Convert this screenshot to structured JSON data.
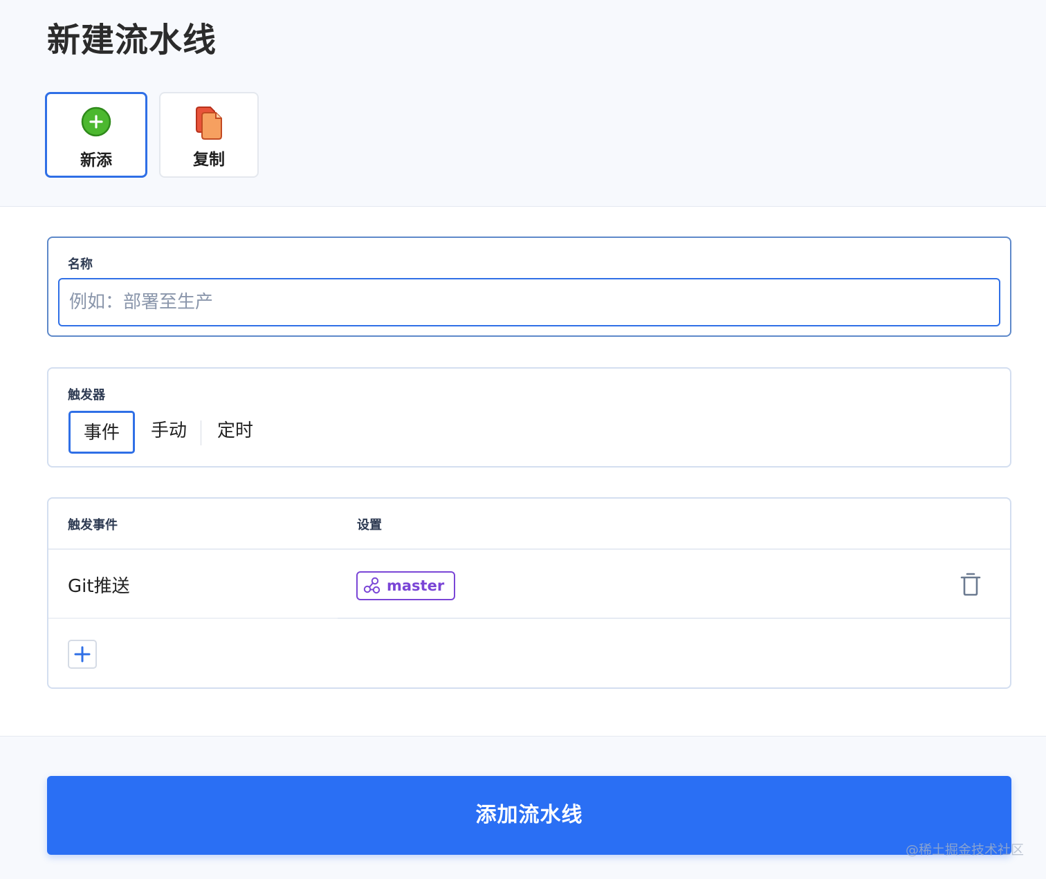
{
  "page": {
    "title": "新建流水线"
  },
  "modes": {
    "new_label": "新添",
    "copy_label": "复制"
  },
  "name_field": {
    "label": "名称",
    "value": "",
    "placeholder": "例如：部署至生产"
  },
  "trigger": {
    "label": "触发器",
    "options": [
      "事件",
      "手动",
      "定时"
    ],
    "selected": "事件"
  },
  "events_table": {
    "headers": [
      "触发事件",
      "设置"
    ],
    "rows": [
      {
        "event": "Git推送",
        "branch": "master"
      }
    ]
  },
  "submit": {
    "label": "添加流水线"
  },
  "watermark": "@稀土掘金技术社区",
  "colors": {
    "primary": "#2a6ff4",
    "branch_chip": "#7a45d6",
    "add_icon": "#4cb82f",
    "copy_icon": "#e8533a"
  },
  "icons": {
    "new": "plus-circle-icon",
    "copy": "copy-document-icon",
    "branch": "git-branch-icon",
    "delete": "trash-icon",
    "add_row": "plus-icon"
  }
}
